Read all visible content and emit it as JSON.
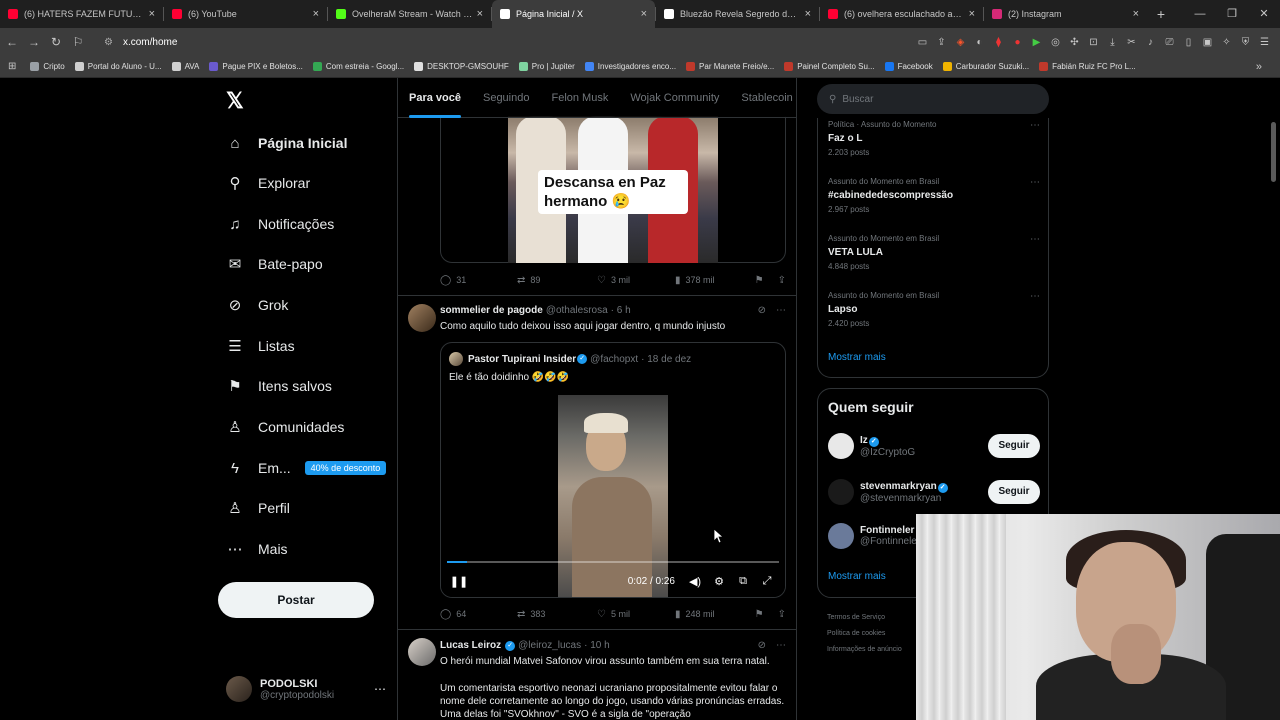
{
  "browser": {
    "tabs": [
      {
        "title": "(6) HATERS FAZEM FUTURA BLUEZE",
        "color": "#ff0033",
        "active": false
      },
      {
        "title": "(6) YouTube",
        "color": "#ff0033",
        "active": false
      },
      {
        "title": "OvelheraM Stream - Watch Live on",
        "color": "#53fc18",
        "active": false
      },
      {
        "title": "Página Inicial / X",
        "color": "#ffffff",
        "active": true
      },
      {
        "title": "Bluezão Revela Segredo de Suelen s",
        "color": "#ffffff",
        "active": false
      },
      {
        "title": "(6) ovelhera esculachado após perde",
        "color": "#ff0033",
        "active": false
      },
      {
        "title": "(2) Instagram",
        "color": "#d62976",
        "active": false
      }
    ],
    "new_tab": "+",
    "url": "x.com/home",
    "bookmarks": [
      {
        "label": "Cripto",
        "color": "#9aa0a6"
      },
      {
        "label": "Portal do Aluno - U...",
        "color": "#cfcfcf"
      },
      {
        "label": "AVA",
        "color": "#d0d0d0"
      },
      {
        "label": "Pague PIX e Boletos...",
        "color": "#6a5acd"
      },
      {
        "label": "Com estreia - Googl...",
        "color": "#34a853"
      },
      {
        "label": "DESKTOP-GMSOUHF",
        "color": "#e0e0e0"
      },
      {
        "label": "Pro | Jupiter",
        "color": "#7fd3a0"
      },
      {
        "label": "Investigadores enco...",
        "color": "#4285f4"
      },
      {
        "label": "Par Manete Freio/e...",
        "color": "#c0392b"
      },
      {
        "label": "Painel Completo Su...",
        "color": "#c0392b"
      },
      {
        "label": "Facebook",
        "color": "#1877f2"
      },
      {
        "label": "Carburador Suzuki...",
        "color": "#f0b400"
      },
      {
        "label": "Fabián Ruiz FC Pro L...",
        "color": "#c0392b"
      }
    ]
  },
  "nav": {
    "items": [
      {
        "label": "Página Inicial",
        "icon": "home-icon",
        "glyph": "⌂"
      },
      {
        "label": "Explorar",
        "icon": "search-icon",
        "glyph": "⚲"
      },
      {
        "label": "Notificações",
        "icon": "bell-icon",
        "glyph": "♫"
      },
      {
        "label": "Bate-papo",
        "icon": "mail-icon",
        "glyph": "✉"
      },
      {
        "label": "Grok",
        "icon": "grok-icon",
        "glyph": "⊘"
      },
      {
        "label": "Listas",
        "icon": "list-icon",
        "glyph": "☰"
      },
      {
        "label": "Itens salvos",
        "icon": "bookmark-icon",
        "glyph": "⚑"
      },
      {
        "label": "Comunidades",
        "icon": "communities-icon",
        "glyph": "♙"
      },
      {
        "label": "Em...",
        "icon": "lightning-icon",
        "glyph": "ϟ"
      },
      {
        "label": "Perfil",
        "icon": "profile-icon",
        "glyph": "♙"
      },
      {
        "label": "Mais",
        "icon": "more-icon",
        "glyph": "⋯"
      }
    ],
    "promo_badge": "40% de desconto",
    "post_button": "Postar",
    "profile_name": "PODOLSKI",
    "profile_handle": "@cryptopodolski"
  },
  "feed": {
    "tabs": [
      "Para você",
      "Seguindo",
      "Felon Musk",
      "Wojak Community",
      "Stablecoin"
    ],
    "post1": {
      "caption": "Descansa en Paz hermano 😢",
      "replies": "31",
      "reposts": "89",
      "likes": "3 mil",
      "views": "378 mil"
    },
    "post2": {
      "name": "sommelier de pagode",
      "handle": "@othalesrosa",
      "time": "· 6 h",
      "text": "Como aquilo tudo deixou isso aqui jogar dentro, q mundo injusto",
      "quote_name": "Pastor Tupirani Insider",
      "quote_handle": "@fachopxt",
      "quote_time": "· 18 de dez",
      "quote_text": "Ele é tão doidinho 🤣🤣🤣",
      "video_time": "0:02 / 0:26",
      "video_progress": 0.06,
      "replies": "64",
      "reposts": "383",
      "likes": "5 mil",
      "views": "248 mil"
    },
    "post3": {
      "name": "Lucas Leiroz",
      "handle": "@leiroz_lucas",
      "time": "· 10 h",
      "text1": "O herói mundial Matvei Safonov virou assunto também em sua terra natal.",
      "text2": "Um comentarista esportivo neonazi ucraniano propositalmente evitou falar o nome dele corretamente ao longo do jogo, usando várias pronúncias erradas. Uma delas foi \"SVOkhnov\" - SVO é a sigla de \"operação"
    }
  },
  "right": {
    "search_placeholder": "Buscar",
    "trends": [
      {
        "context": "Política · Assunto do Momento",
        "title": "Faz o L",
        "count": "2.203 posts"
      },
      {
        "context": "Assunto do Momento em Brasil",
        "title": "#cabinededescompressão",
        "count": "2.967 posts"
      },
      {
        "context": "Assunto do Momento em Brasil",
        "title": "VETA LULA",
        "count": "4.848 posts"
      },
      {
        "context": "Assunto do Momento em Brasil",
        "title": "Lapso",
        "count": "2.420 posts"
      }
    ],
    "show_more": "Mostrar mais",
    "who_to_follow_title": "Quem seguir",
    "follow_suggestions": [
      {
        "name": "Iz",
        "handle": "@IzCryptoG",
        "button": "Seguir"
      },
      {
        "name": "stevenmarkryan",
        "handle": "@stevenmarkryan",
        "button": "Seguir"
      },
      {
        "name": "Fontinneler",
        "handle": "@Fontinnele"
      }
    ],
    "show_more2": "Mostrar mais",
    "footer": [
      "Termos de Serviço",
      "Política de cookies",
      "Informações de anúncio"
    ]
  }
}
